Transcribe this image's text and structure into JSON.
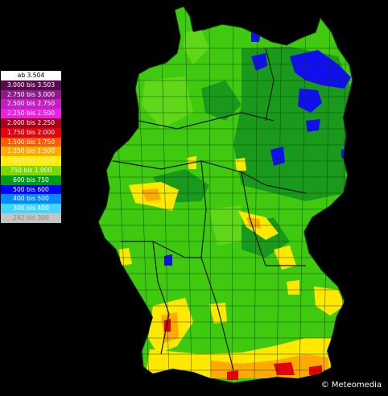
{
  "legend": [
    {
      "label": "ab 3.504",
      "color": "#ffffff",
      "text_color": "#000000"
    },
    {
      "label": "3.000 bis 3.503",
      "color": "#5a0b4e",
      "text_color": "#ffffff"
    },
    {
      "label": "2.750 bis 3.000",
      "color": "#8d1a86",
      "text_color": "#ffffff"
    },
    {
      "label": "2.500 bis 2.750",
      "color": "#c21fc2",
      "text_color": "#ffffff"
    },
    {
      "label": "2.250 bis 2.500",
      "color": "#f01de8",
      "text_color": "#ffffff"
    },
    {
      "label": "2.000 bis 2.250",
      "color": "#a8001a",
      "text_color": "#ffffff"
    },
    {
      "label": "1.750 bis 2.000",
      "color": "#e8000d",
      "text_color": "#ffffff"
    },
    {
      "label": "1.500 bis 1.750",
      "color": "#ff5a00",
      "text_color": "#ffffff"
    },
    {
      "label": "1.250 bis 1.500",
      "color": "#ffaa00",
      "text_color": "#ffffff"
    },
    {
      "label": "1.000 bis 1.250",
      "color": "#ffee00",
      "text_color": "#e6e6e6"
    },
    {
      "label": "750 bis 1.000",
      "color": "#7bd900",
      "text_color": "#ffffff"
    },
    {
      "label": "600 bis 750",
      "color": "#009a1a",
      "text_color": "#ffffff"
    },
    {
      "label": "500 bis 600",
      "color": "#0000ff",
      "text_color": "#ffffff"
    },
    {
      "label": "400 bis 500",
      "color": "#008aff",
      "text_color": "#ffffff"
    },
    {
      "label": "300 bis 400",
      "color": "#45d6ff",
      "text_color": "#ffffff"
    },
    {
      "label": "242 bis 300",
      "color": "#c4c4c4",
      "text_color": "#888888"
    }
  ],
  "credit": "© Meteomedia",
  "colors": {
    "background": "#000000",
    "land_base": "#3fca10",
    "boundary": "#1a3a0a"
  }
}
